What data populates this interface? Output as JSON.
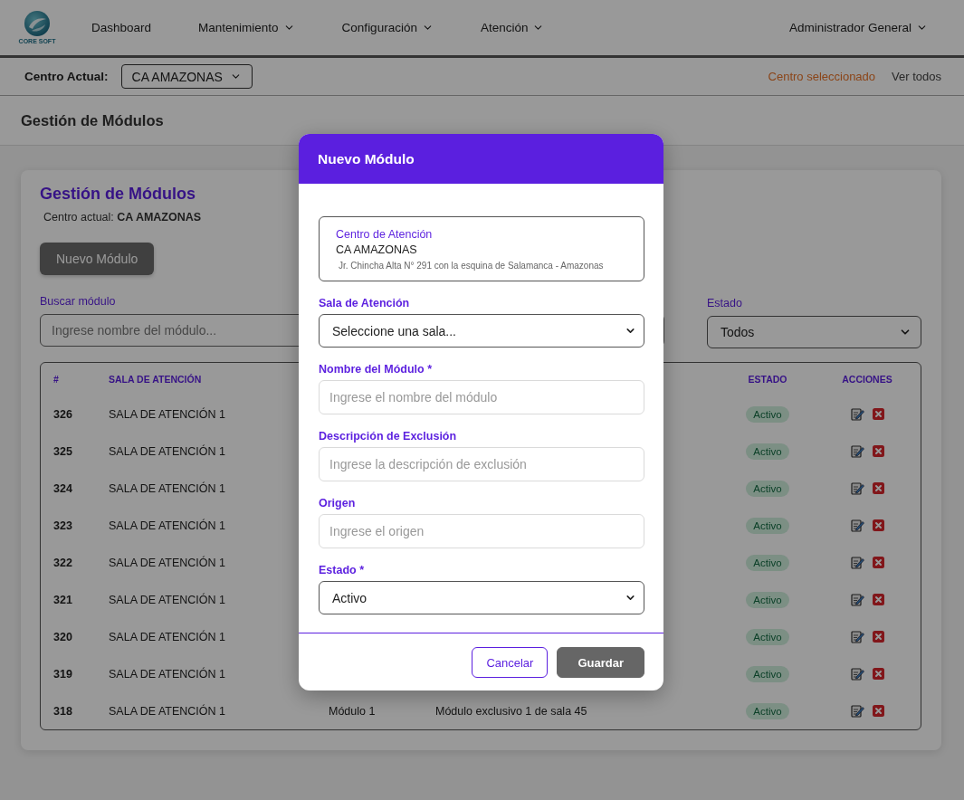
{
  "navbar": {
    "logo_text": "CORE SOFT",
    "items": [
      {
        "label": "Dashboard",
        "dropdown": false
      },
      {
        "label": "Mantenimiento",
        "dropdown": true
      },
      {
        "label": "Configuración",
        "dropdown": true
      },
      {
        "label": "Atención",
        "dropdown": true
      }
    ],
    "user": {
      "label": "Administrador General",
      "dropdown": true
    }
  },
  "center_bar": {
    "label": "Centro Actual:",
    "current": "CA AMAZONAS",
    "links": [
      {
        "label": "Centro seleccionado",
        "selected": true
      },
      {
        "label": "Ver todos",
        "selected": false
      }
    ]
  },
  "page_title": "Gestión de Módulos",
  "card": {
    "title": "Gestión de Módulos",
    "subtitle": "Centro actual: **CA AMAZONAS**",
    "new_button": "Nuevo Módulo",
    "search": {
      "label": "Buscar módulo",
      "placeholder": "Ingrese nombre del módulo..."
    },
    "status_filter": {
      "label": "Estado",
      "value": "Todos"
    }
  },
  "table": {
    "columns": [
      "#",
      "SALA DE ATENCIÓN",
      "ESTADO",
      "ACCIONES"
    ],
    "rows": [
      {
        "number": "326",
        "sala": "SALA DE ATENCIÓN 1",
        "estado": "Activo"
      },
      {
        "number": "325",
        "sala": "SALA DE ATENCIÓN 1",
        "estado": "Activo"
      },
      {
        "number": "324",
        "sala": "SALA DE ATENCIÓN 1",
        "estado": "Activo"
      },
      {
        "number": "323",
        "sala": "SALA DE ATENCIÓN 1",
        "estado": "Activo"
      },
      {
        "number": "322",
        "sala": "SALA DE ATENCIÓN 1",
        "estado": "Activo"
      },
      {
        "number": "321",
        "sala": "SALA DE ATENCIÓN 1",
        "estado": "Activo"
      },
      {
        "number": "320",
        "sala": "SALA DE ATENCIÓN 1",
        "estado": "Activo"
      },
      {
        "number": "319",
        "sala": "SALA DE ATENCIÓN 1",
        "estado": "Activo"
      },
      {
        "number": "318",
        "sala": "SALA DE ATENCIÓN 1",
        "column_3": "Módulo 1",
        "column_4": "Módulo exclusivo 1 de sala 45",
        "estado": "Activo"
      }
    ]
  },
  "modal": {
    "title": "Nuevo Módulo",
    "center": {
      "label": "Centro de Atención",
      "name": "CA AMAZONAS",
      "address": "Jr. Chincha Alta N° 291 con la esquina de Salamanca - Amazonas"
    },
    "fields": [
      {
        "kind": "select",
        "label": "Sala de Atención",
        "value": "Seleccione una sala..."
      },
      {
        "kind": "input",
        "label": "Nombre del Módulo *",
        "placeholder": "Ingrese el nombre del módulo"
      },
      {
        "kind": "input",
        "label": "Descripción de Exclusión",
        "placeholder": "Ingrese la descripción de exclusión"
      },
      {
        "kind": "input",
        "label": "Origen",
        "placeholder": "Ingrese el origen"
      },
      {
        "kind": "select",
        "label": "Estado *",
        "value": "Activo"
      }
    ],
    "buttons": [
      {
        "label": "Cancelar",
        "kind": "secondary"
      },
      {
        "label": "Guardar",
        "kind": "primary"
      }
    ]
  }
}
